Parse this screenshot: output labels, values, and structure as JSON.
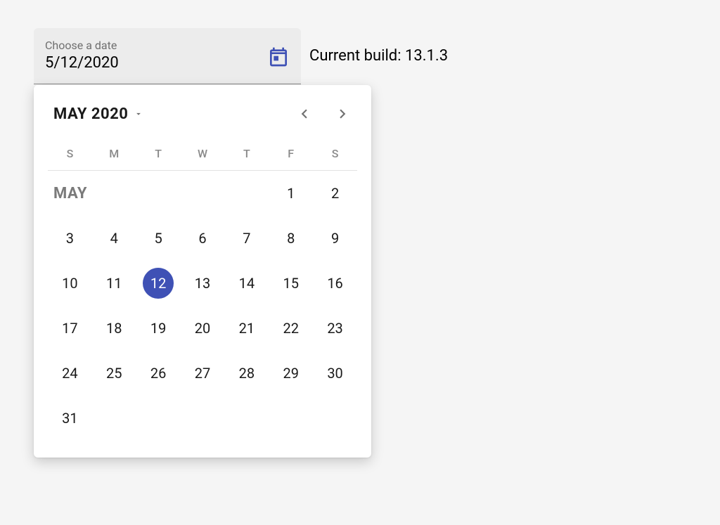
{
  "field": {
    "label": "Choose a date",
    "value": "5/12/2020"
  },
  "build": {
    "prefix": "Current build: ",
    "version": "13.1.3"
  },
  "popover": {
    "header": {
      "label": "MAY 2020"
    },
    "dow": [
      "S",
      "M",
      "T",
      "W",
      "T",
      "F",
      "S"
    ],
    "month_label": "MAY",
    "first_dow": 5,
    "selected_day": 12,
    "days": [
      1,
      2,
      3,
      4,
      5,
      6,
      7,
      8,
      9,
      10,
      11,
      12,
      13,
      14,
      15,
      16,
      17,
      18,
      19,
      20,
      21,
      22,
      23,
      24,
      25,
      26,
      27,
      28,
      29,
      30,
      31
    ]
  },
  "colors": {
    "accent": "#3f51b5"
  }
}
